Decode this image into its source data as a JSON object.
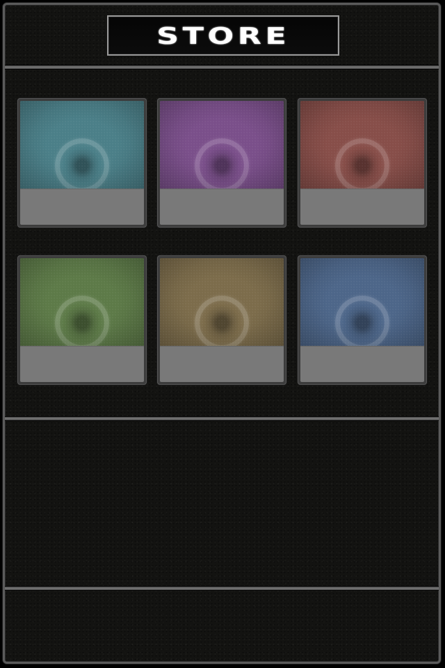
{
  "header": {
    "title": "STORE"
  },
  "store": {
    "items": [
      {
        "name": "item-teal",
        "color": "#4b7f88",
        "label": ""
      },
      {
        "name": "item-purple",
        "color": "#7a4f8a",
        "label": ""
      },
      {
        "name": "item-red",
        "color": "#874e49",
        "label": ""
      },
      {
        "name": "item-green",
        "color": "#5d7a48",
        "label": ""
      },
      {
        "name": "item-tan",
        "color": "#7c6c4b",
        "label": ""
      },
      {
        "name": "item-blue",
        "color": "#4d6689",
        "label": ""
      }
    ]
  },
  "colors": {
    "frame_border": "#5a5a5a",
    "background": "#131311",
    "title_border": "#9a9a9a",
    "tile_label_bg": "#797979"
  }
}
